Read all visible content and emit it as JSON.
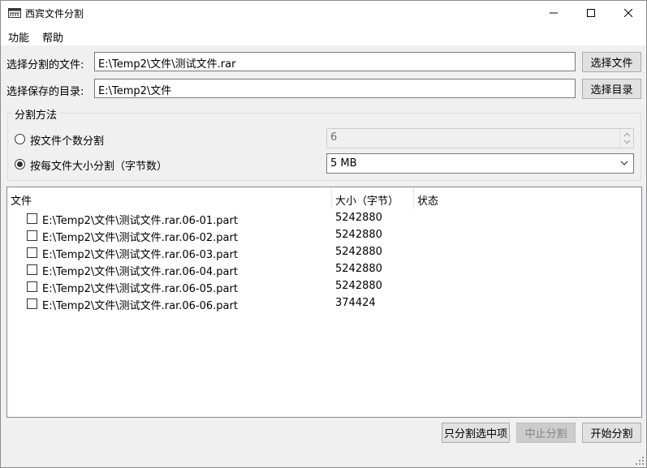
{
  "window": {
    "title": "西宾文件分割"
  },
  "menu": {
    "items": [
      "功能",
      "帮助"
    ]
  },
  "file_select": {
    "label": "选择分割的文件:",
    "value": "E:\\Temp2\\文件\\测试文件.rar",
    "button": "选择文件"
  },
  "dir_select": {
    "label": "选择保存的目录:",
    "value": "E:\\Temp2\\文件",
    "button": "选择目录"
  },
  "split_method": {
    "group_title": "分割方法",
    "by_count_label": "按文件个数分割",
    "by_count_value": "6",
    "by_count_selected": false,
    "by_size_label": "按每文件大小分割（字节数）",
    "by_size_value": "5 MB",
    "by_size_selected": true
  },
  "list": {
    "columns": [
      "文件",
      "大小（字节）",
      "状态"
    ],
    "rows": [
      {
        "name": "E:\\Temp2\\文件\\测试文件.rar.06-01.part",
        "size": "5242880",
        "status": ""
      },
      {
        "name": "E:\\Temp2\\文件\\测试文件.rar.06-02.part",
        "size": "5242880",
        "status": ""
      },
      {
        "name": "E:\\Temp2\\文件\\测试文件.rar.06-03.part",
        "size": "5242880",
        "status": ""
      },
      {
        "name": "E:\\Temp2\\文件\\测试文件.rar.06-04.part",
        "size": "5242880",
        "status": ""
      },
      {
        "name": "E:\\Temp2\\文件\\测试文件.rar.06-05.part",
        "size": "5242880",
        "status": ""
      },
      {
        "name": "E:\\Temp2\\文件\\测试文件.rar.06-06.part",
        "size": "374424",
        "status": ""
      }
    ]
  },
  "actions": {
    "split_selected": "只分割选中项",
    "stop": "中止分割",
    "start": "开始分割"
  },
  "icons": {
    "app": "scissors-app-icon",
    "minimize": "minimize-icon",
    "maximize": "maximize-icon",
    "close": "close-icon",
    "dropdown": "chevron-down-icon",
    "spinner": "spinner-arrows-icon",
    "resize": "resize-grip-icon"
  }
}
